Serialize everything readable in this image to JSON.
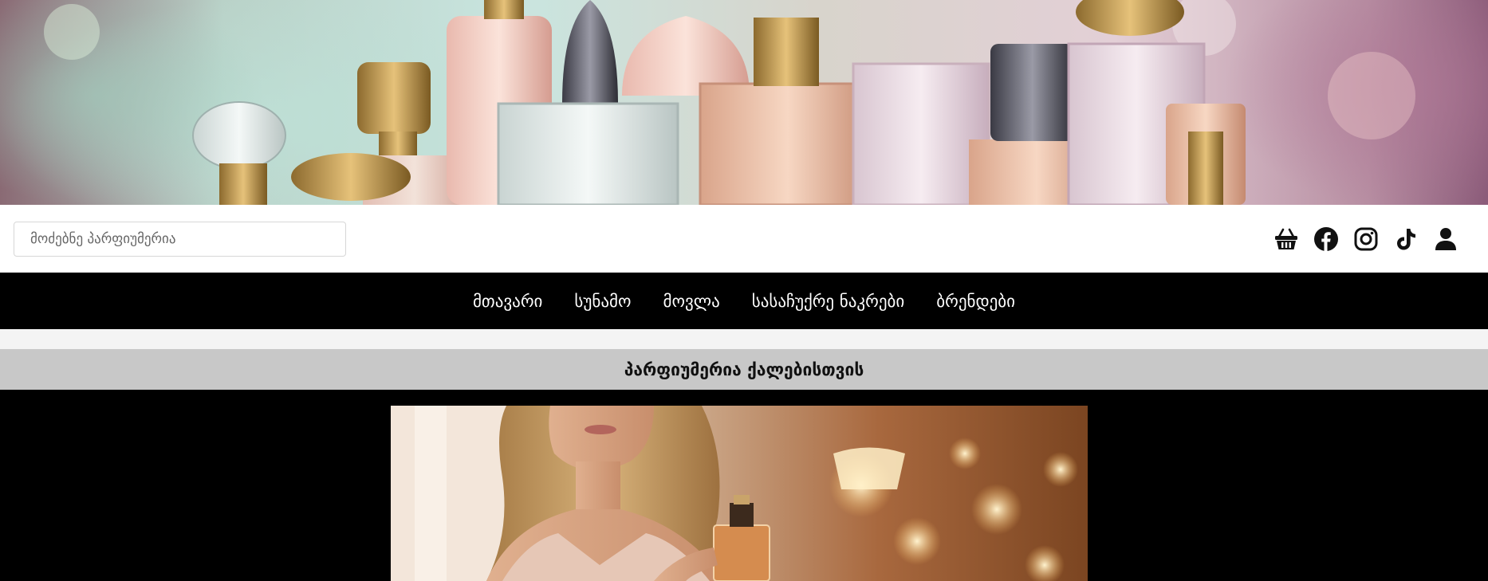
{
  "hero": {
    "image": "perfume-bottles-banner"
  },
  "search": {
    "placeholder": "მოძებნე პარფიუმერია"
  },
  "header_icons": [
    "basket-icon",
    "facebook-icon",
    "instagram-icon",
    "tiktok-icon",
    "user-icon"
  ],
  "nav": {
    "items": [
      {
        "label": "მთავარი"
      },
      {
        "label": "სუნამო"
      },
      {
        "label": "მოვლა"
      },
      {
        "label": "სასაჩუქრე ნაკრები"
      },
      {
        "label": "ბრენდები"
      }
    ]
  },
  "section": {
    "title": "პარფიუმერია ქალებისთვის"
  },
  "feature": {
    "image": "woman-with-perfume-photo"
  },
  "colors": {
    "nav_bg": "#000000",
    "section_bg": "#c8c8c8",
    "page_bg": "#f4f4f4"
  }
}
